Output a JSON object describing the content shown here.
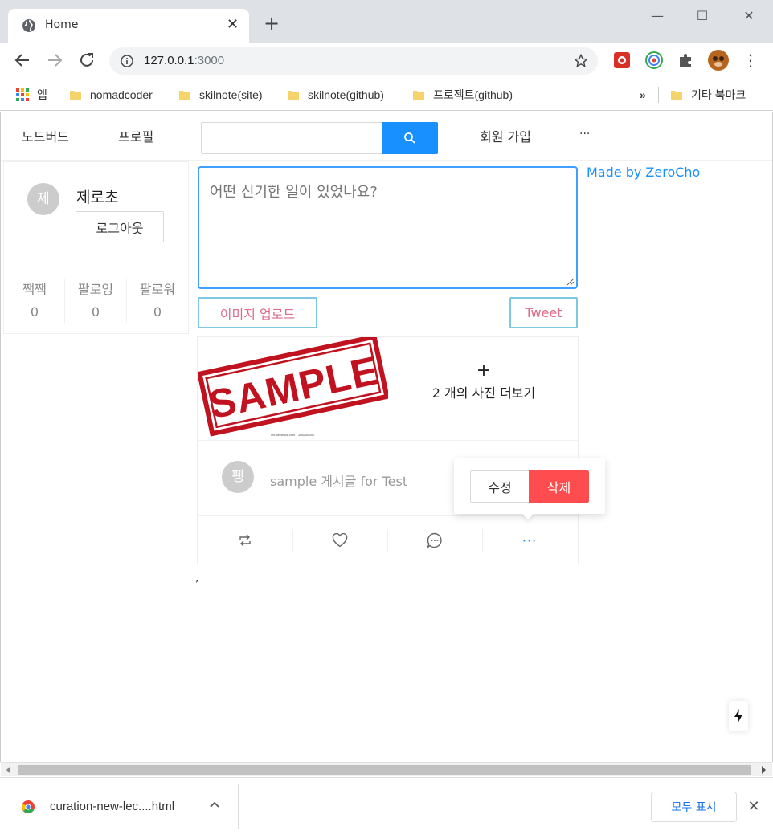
{
  "browser": {
    "tab_title": "Home",
    "url_host": "127.0.0.1",
    "url_port": ":3000",
    "bookmarks": [
      {
        "label": "앱"
      },
      {
        "label": "nomadcoder"
      },
      {
        "label": "skilnote(site)"
      },
      {
        "label": "skilnote(github)"
      },
      {
        "label": "프로젝트(github)"
      }
    ],
    "overflow_label": "»",
    "other_bookmarks": "기타 북마크"
  },
  "menu": {
    "items": [
      {
        "label": "노드버드"
      },
      {
        "label": "프로필"
      }
    ],
    "signup": "회원 가입",
    "more": "...",
    "search_value": "",
    "search_placeholder": ""
  },
  "profile": {
    "avatar_initial": "제",
    "nickname": "제로초",
    "logout_label": "로그아웃",
    "stats": [
      {
        "label": "짹짹",
        "value": "0"
      },
      {
        "label": "팔로잉",
        "value": "0"
      },
      {
        "label": "팔로워",
        "value": "0"
      }
    ]
  },
  "post_form": {
    "placeholder": "어떤 신기한 일이 있었나요?",
    "upload_label": "이미지 업로드",
    "tweet_label": "Tweet"
  },
  "made_by": "Made by ZeroCho",
  "post": {
    "image_text": "SAMPLE",
    "image_caption": "shutterstock.com · 308250266",
    "more_plus": "+",
    "more_photos": "2 개의 사진 더보기",
    "author_initial": "펭",
    "content": "sample 게시글 for Test",
    "actions": [
      {
        "icon": "retweet-icon"
      },
      {
        "icon": "heart-icon"
      },
      {
        "icon": "comment-icon"
      },
      {
        "icon": "ellipsis-icon",
        "label": "···"
      }
    ]
  },
  "stray_text": ",",
  "popover": {
    "edit_label": "수정",
    "delete_label": "삭제"
  },
  "download": {
    "file_name": "curation-new-lec....html",
    "show_all": "모두 표시"
  },
  "colors": {
    "primary": "#1890ff",
    "danger": "#ff4d4f",
    "button_text_pink": "#e06a8a",
    "button_border_cyan": "#7ec8e3"
  }
}
